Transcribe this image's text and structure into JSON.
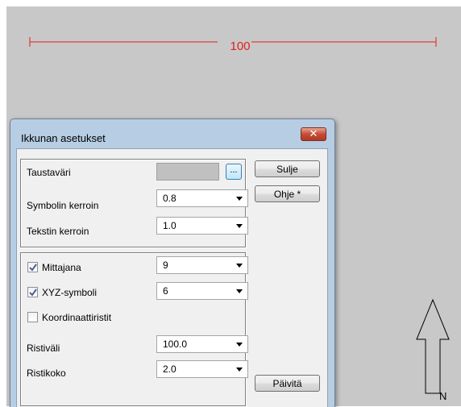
{
  "canvas": {
    "background": "#c8c8c8",
    "scale_label": "100",
    "scale_color": "#e02020",
    "north_label": "N"
  },
  "dialog": {
    "title": "Ikkunan asetukset",
    "close_glyph": "✕",
    "close_icon": "close-icon",
    "group1": {
      "background_label": "Taustaväri",
      "background_color": "#c0c0c0",
      "browse_label": "...",
      "symbol_factor_label": "Symbolin kerroin",
      "symbol_factor_value": "0.8",
      "text_factor_label": "Tekstin kerroin",
      "text_factor_value": "1.0"
    },
    "group2": {
      "dimension_line_label": "Mittajana",
      "dimension_line_checked": true,
      "dimension_line_value": "9",
      "xyz_symbol_label": "XYZ-symboli",
      "xyz_symbol_checked": true,
      "xyz_symbol_value": "6",
      "coordinate_cross_label": "Koordinaattiristit",
      "coordinate_cross_checked": false,
      "cross_spacing_label": "Ristiväli",
      "cross_spacing_value": "100.0",
      "cross_size_label": "Ristikoko",
      "cross_size_value": "2.0"
    },
    "buttons": {
      "close_label": "Sulje",
      "help_label": "Ohje *",
      "update_label": "Päivitä"
    }
  }
}
